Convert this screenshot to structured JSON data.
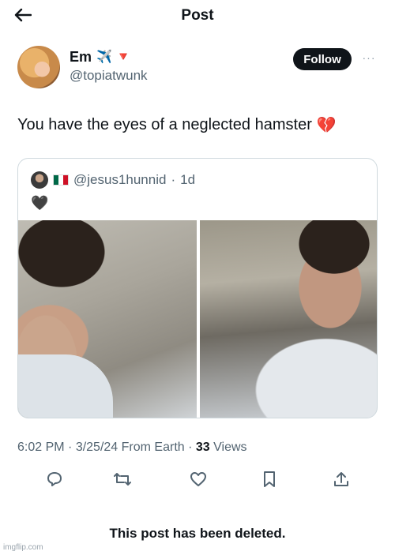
{
  "header": {
    "title": "Post"
  },
  "author": {
    "name": "Em",
    "name_emojis": "✈️ 🔻",
    "handle": "@topiatwunk",
    "follow_label": "Follow",
    "more_label": "···"
  },
  "tweet": {
    "text": "You have the eyes of a neglected hamster",
    "emoji": "💔"
  },
  "quoted": {
    "flag": "🇲🇽",
    "handle": "@jesus1hunnid",
    "separator": "·",
    "age": "1d",
    "text": "🖤"
  },
  "meta": {
    "time": "6:02 PM",
    "date": "3/25/24",
    "source": "From Earth",
    "views_count": "33",
    "views_label": "Views"
  },
  "actions": [
    "reply-icon",
    "retweet-icon",
    "like-icon",
    "bookmark-icon",
    "share-icon"
  ],
  "notice": {
    "text": "This post has been deleted."
  },
  "watermark": {
    "text": "imgflip.com"
  },
  "colors": {
    "text": "#0f1419",
    "muted": "#536471",
    "border": "#cfd9de"
  }
}
